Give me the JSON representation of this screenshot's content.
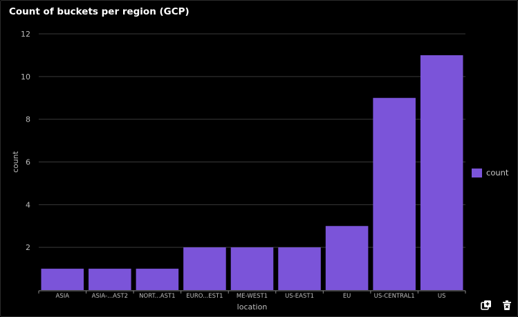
{
  "panel": {
    "title": "Count of buckets per region (GCP)"
  },
  "chart_data": {
    "type": "bar",
    "xlabel": "location",
    "ylabel": "count",
    "categories": [
      "ASIA",
      "ASIA-...AST2",
      "NORT...AST1",
      "EURO...EST1",
      "ME-WEST1",
      "US-EAST1",
      "EU",
      "US-CENTRAL1",
      "US"
    ],
    "series": [
      {
        "name": "count",
        "values": [
          1,
          1,
          1,
          2,
          2,
          2,
          3,
          9,
          11
        ],
        "color": "#7b54d9"
      }
    ],
    "ylim": [
      0,
      12
    ],
    "yticks": [
      2,
      4,
      6,
      8,
      10,
      12
    ],
    "grid": true,
    "legend": "right"
  },
  "toolbar": {
    "clone_icon": "clone-panel-icon",
    "delete_icon": "trash-icon"
  },
  "colors": {
    "background": "#000000",
    "grid": "#3a3a3a",
    "axis_text": "#bdbdbd",
    "bar": "#7b54d9"
  }
}
